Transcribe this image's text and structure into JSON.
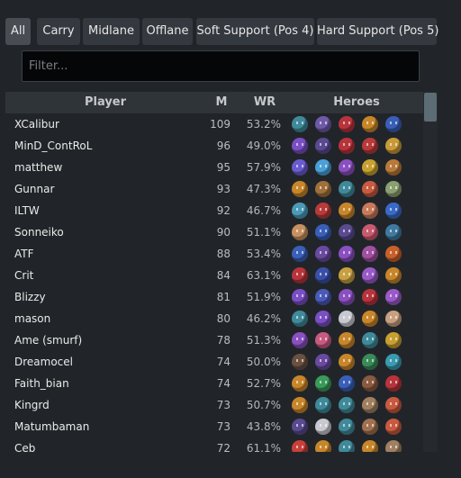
{
  "tabs": [
    {
      "label": "All",
      "active": true
    },
    {
      "label": "Carry",
      "active": false
    },
    {
      "label": "Midlane",
      "active": false
    },
    {
      "label": "Offlane",
      "active": false
    },
    {
      "label": "Soft Support (Pos 4)",
      "active": false
    },
    {
      "label": "Hard Support (Pos 5)",
      "active": false
    }
  ],
  "filter": {
    "placeholder": "Filter...",
    "value": ""
  },
  "columns": {
    "player": "Player",
    "matches": "M",
    "winrate": "WR",
    "heroes": "Heroes"
  },
  "rows": [
    {
      "player": "XCalibur",
      "matches": "109",
      "winrate": "53.2%",
      "heroes": [
        "#3f8a9a",
        "#6f5aa8",
        "#b8343c",
        "#c8862a",
        "#3a5fb8"
      ]
    },
    {
      "player": "MinD_ContRoL",
      "matches": "96",
      "winrate": "49.0%",
      "heroes": [
        "#7a4fc4",
        "#5a4a90",
        "#b8343c",
        "#b83a3a",
        "#c89a38"
      ]
    },
    {
      "player": "matthew",
      "matches": "95",
      "winrate": "57.9%",
      "heroes": [
        "#6b5bd0",
        "#4aa0d8",
        "#8a4fc0",
        "#c8a030",
        "#b87a3a"
      ]
    },
    {
      "player": "Gunnar",
      "matches": "93",
      "winrate": "47.3%",
      "heroes": [
        "#c8862a",
        "#a0703a",
        "#3f8a9a",
        "#c85a40",
        "#8aa070"
      ]
    },
    {
      "player": "ILTW",
      "matches": "92",
      "winrate": "46.7%",
      "heroes": [
        "#4a9ab8",
        "#b83a3a",
        "#c8862a",
        "#c87a5a",
        "#3a6ac8"
      ]
    },
    {
      "player": "Sonneiko",
      "matches": "90",
      "winrate": "51.1%",
      "heroes": [
        "#c89060",
        "#3a5fb8",
        "#5a4a90",
        "#c85a70",
        "#3f7aa0"
      ]
    },
    {
      "player": "ATF",
      "matches": "88",
      "winrate": "53.4%",
      "heroes": [
        "#3a5fb8",
        "#6a4aa0",
        "#8a4fc0",
        "#a050a0",
        "#c8602a"
      ]
    },
    {
      "player": "Crit",
      "matches": "84",
      "winrate": "63.1%",
      "heroes": [
        "#b8343c",
        "#3a4fa8",
        "#c8a040",
        "#9a5ac8",
        "#c8862a"
      ]
    },
    {
      "player": "Blizzy",
      "matches": "81",
      "winrate": "51.9%",
      "heroes": [
        "#7a4fc4",
        "#4a5ab8",
        "#8a4fc0",
        "#b8343c",
        "#9a5ac8"
      ]
    },
    {
      "player": "mason",
      "matches": "80",
      "winrate": "46.2%",
      "heroes": [
        "#3f8a9a",
        "#7a4fc4",
        "#c8c8d0",
        "#c8862a",
        "#c8a080"
      ]
    },
    {
      "player": "Ame (smurf)",
      "matches": "78",
      "winrate": "51.3%",
      "heroes": [
        "#8a4fc0",
        "#c85a80",
        "#c8862a",
        "#3f8a9a",
        "#c8a030"
      ]
    },
    {
      "player": "Dreamocel",
      "matches": "74",
      "winrate": "50.0%",
      "heroes": [
        "#6a5040",
        "#6a4aa0",
        "#c8862a",
        "#3a8a5a",
        "#3a9ab0"
      ]
    },
    {
      "player": "Faith_bian",
      "matches": "74",
      "winrate": "52.7%",
      "heroes": [
        "#c8862a",
        "#3a9a5a",
        "#3a5fb8",
        "#8a5a40",
        "#b8343c"
      ]
    },
    {
      "player": "Kingrd",
      "matches": "73",
      "winrate": "50.7%",
      "heroes": [
        "#c8862a",
        "#3f8a9a",
        "#3f8a9a",
        "#a08060",
        "#c85a40"
      ]
    },
    {
      "player": "Matumbaman",
      "matches": "73",
      "winrate": "43.8%",
      "heroes": [
        "#5a4a90",
        "#c8c8d0",
        "#3f8a9a",
        "#a07050",
        "#c85a40"
      ]
    },
    {
      "player": "Ceb",
      "matches": "72",
      "winrate": "61.1%",
      "heroes": [
        "#c8403a",
        "#c8862a",
        "#3f8a9a",
        "#c8862a",
        "#a08060"
      ]
    }
  ]
}
